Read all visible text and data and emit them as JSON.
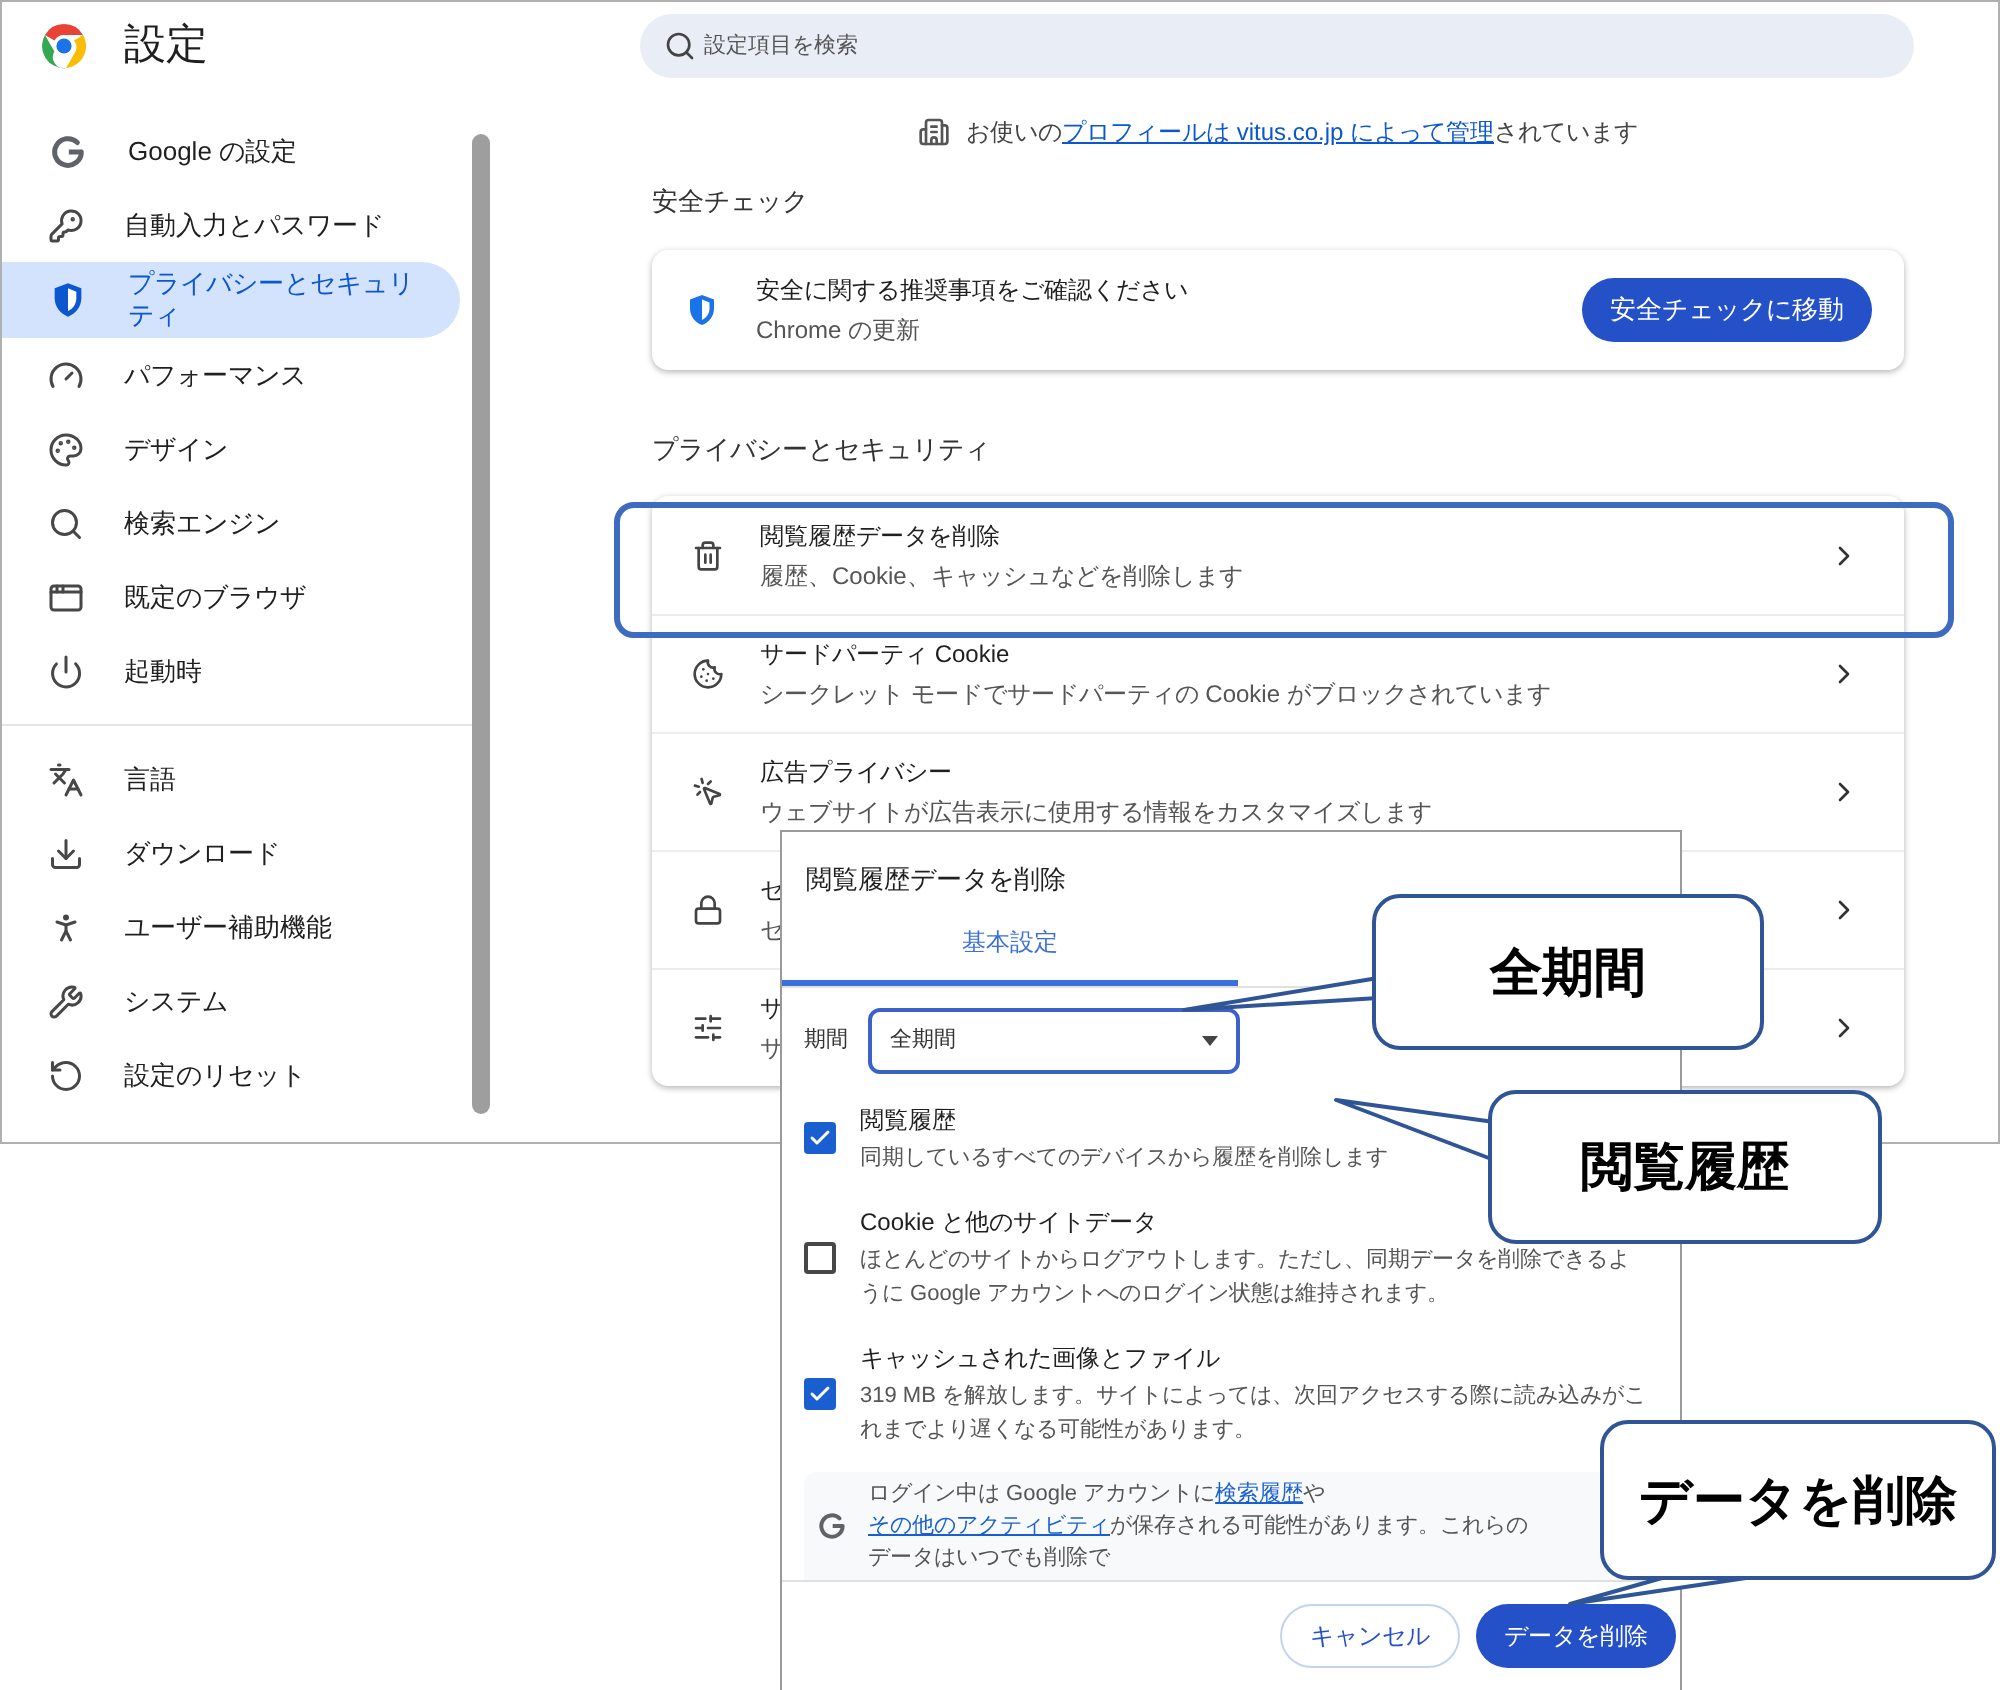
{
  "app": {
    "title": "設定"
  },
  "search": {
    "placeholder": "設定項目を検索"
  },
  "sidebar": {
    "groups": [
      {
        "items": [
          {
            "label": "Google の設定",
            "selected": false
          },
          {
            "label": "自動入力とパスワード",
            "selected": false
          },
          {
            "label": "プライバシーとセキュリティ",
            "selected": true
          },
          {
            "label": "パフォーマンス",
            "selected": false
          },
          {
            "label": "デザイン",
            "selected": false
          },
          {
            "label": "検索エンジン",
            "selected": false
          },
          {
            "label": "既定のブラウザ",
            "selected": false
          },
          {
            "label": "起動時",
            "selected": false
          }
        ]
      },
      {
        "items": [
          {
            "label": "言語",
            "selected": false
          },
          {
            "label": "ダウンロード",
            "selected": false
          },
          {
            "label": "ユーザー補助機能",
            "selected": false
          },
          {
            "label": "システム",
            "selected": false
          },
          {
            "label": "設定のリセット",
            "selected": false
          }
        ]
      }
    ]
  },
  "managed_notice": {
    "before": "お使いの",
    "link": "プロフィールは vitus.co.jp によって管理",
    "after": "されています"
  },
  "safety_check": {
    "heading": "安全チェック",
    "title": "安全に関する推奨事項をご確認ください",
    "subtitle": "Chrome の更新",
    "button": "安全チェックに移動"
  },
  "privacy": {
    "heading": "プライバシーとセキュリティ",
    "rows": [
      {
        "title": "閲覧履歴データを削除",
        "subtitle": "履歴、Cookie、キャッシュなどを削除します",
        "highlighted": true
      },
      {
        "title": "サードパーティ Cookie",
        "subtitle": "シークレット モードでサードパーティの Cookie がブロックされています",
        "highlighted": false
      },
      {
        "title": "広告プライバシー",
        "subtitle": "ウェブサイトが広告表示に使用する情報をカスタマイズします",
        "highlighted": false
      },
      {
        "title": "セ",
        "subtitle": "セ",
        "highlighted": false
      },
      {
        "title": "サ",
        "subtitle": "サ",
        "highlighted": false
      }
    ]
  },
  "dialog": {
    "title": "閲覧履歴データを削除",
    "tabs": [
      {
        "label": "基本設定",
        "selected": true
      }
    ],
    "period": {
      "label": "期間",
      "value": "全期間"
    },
    "options": [
      {
        "title": "閲覧履歴",
        "description": "同期しているすべてのデバイスから履歴を削除します",
        "checked": true
      },
      {
        "title": "Cookie と他のサイトデータ",
        "description": "ほとんどのサイトからログアウトします。ただし、同期データを削除できるように Google アカウントへのログイン状態は維持されます。",
        "checked": false
      },
      {
        "title": "キャッシュされた画像とファイル",
        "description": "319 MB を解放します。サイトによっては、次回アクセスする際に読み込みがこれまでより遅くなる可能性があります。",
        "checked": true
      }
    ],
    "notice": {
      "text1": "ログイン中は Google アカウントに",
      "link1": "検索履歴",
      "text2": "や",
      "link2": "その他のアクティビティ",
      "text3": "が保存される可能性があります。これらのデータはいつでも削除で"
    },
    "buttons": [
      {
        "label": "キャンセル",
        "kind": "secondary"
      },
      {
        "label": "データを削除",
        "kind": "primary"
      }
    ]
  },
  "annotations": [
    {
      "text": "全期間"
    },
    {
      "text": "閲覧履歴"
    },
    {
      "text": "データを削除"
    }
  ]
}
